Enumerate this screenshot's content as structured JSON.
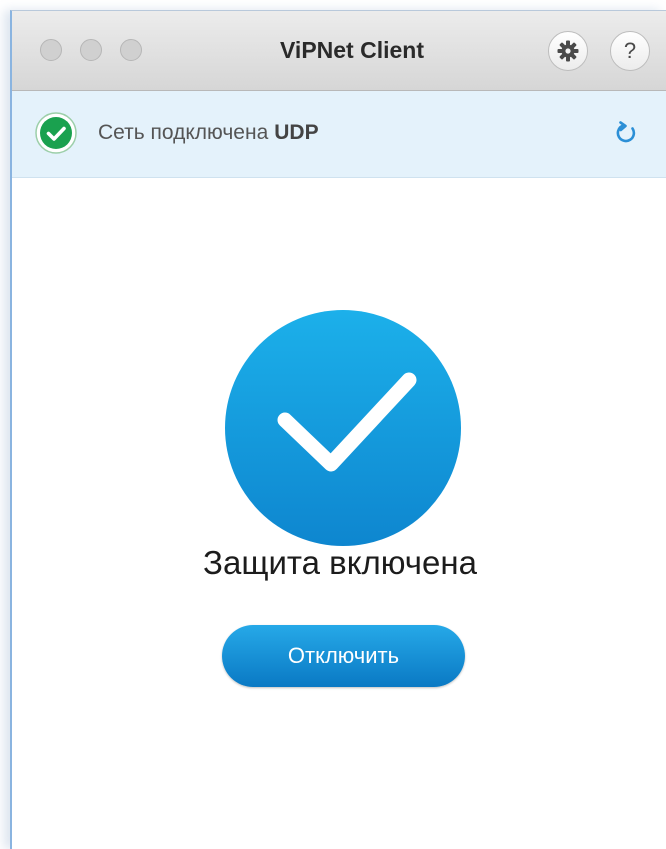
{
  "window": {
    "title": "ViPNet Client"
  },
  "toolbar": {
    "settings_icon": "gear-icon",
    "help_label": "?"
  },
  "status": {
    "text": "Сеть подключена",
    "protocol": "UDP",
    "icon": "check-circle-icon",
    "icon_color": "#1aa14f",
    "refresh_icon": "refresh-icon"
  },
  "main": {
    "state_icon": "checkmark-icon",
    "state_label": "Защита включена",
    "disconnect_label": "Отключить",
    "accent_color": "#0d8fd8"
  }
}
